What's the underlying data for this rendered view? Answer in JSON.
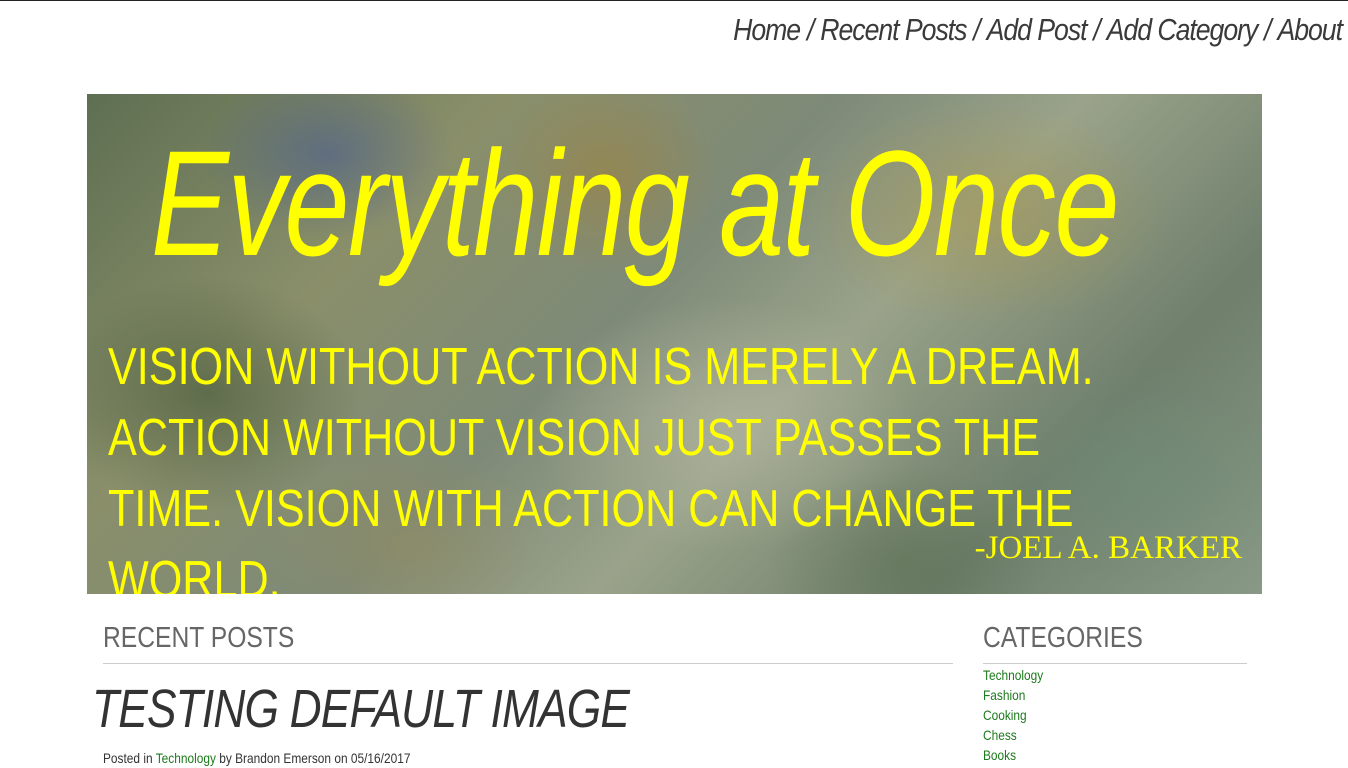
{
  "nav": {
    "items": [
      {
        "label": "Home"
      },
      {
        "label": "Recent Posts"
      },
      {
        "label": "Add Post"
      },
      {
        "label": "Add Category"
      },
      {
        "label": "About"
      }
    ],
    "separator": "/"
  },
  "hero": {
    "title": "Everything at Once",
    "quote": "Vision without action is merely a dream. Action without vision just passes the time. Vision with action can change the world.",
    "author": "-Joel A. Barker"
  },
  "recent_posts": {
    "heading": "Recent Posts",
    "posts": [
      {
        "title": "Testing Default Image",
        "posted_in_prefix": "Posted in",
        "category": "Technology",
        "by_prefix": "by",
        "author": "Brandon Emerson",
        "on_prefix": "on",
        "date": "05/16/2017"
      }
    ]
  },
  "categories": {
    "heading": "Categories",
    "items": [
      {
        "label": "Technology"
      },
      {
        "label": "Fashion"
      },
      {
        "label": "Cooking"
      },
      {
        "label": "Chess"
      },
      {
        "label": "Books"
      }
    ]
  },
  "colors": {
    "accent_yellow": "#ffff00",
    "link_green": "#1e7a1e",
    "heading_gray": "#666666",
    "text_dark": "#333333"
  }
}
